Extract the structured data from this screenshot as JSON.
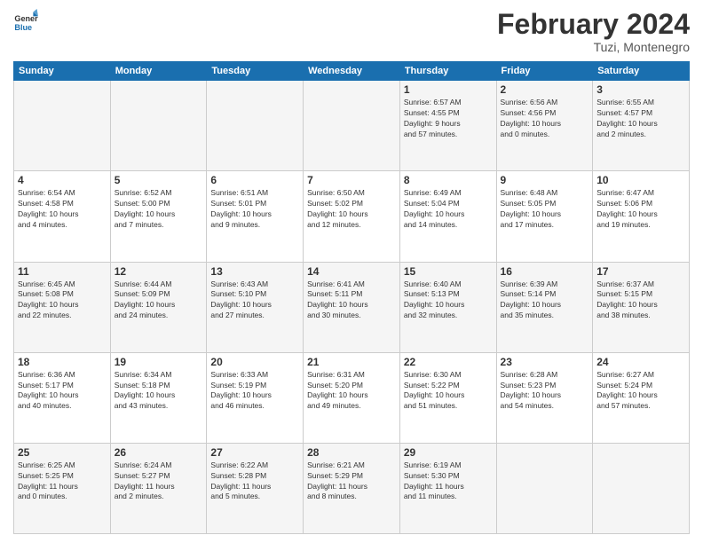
{
  "logo": {
    "line1": "General",
    "line2": "Blue"
  },
  "title": "February 2024",
  "location": "Tuzi, Montenegro",
  "headers": [
    "Sunday",
    "Monday",
    "Tuesday",
    "Wednesday",
    "Thursday",
    "Friday",
    "Saturday"
  ],
  "weeks": [
    [
      {
        "day": "",
        "info": ""
      },
      {
        "day": "",
        "info": ""
      },
      {
        "day": "",
        "info": ""
      },
      {
        "day": "",
        "info": ""
      },
      {
        "day": "1",
        "info": "Sunrise: 6:57 AM\nSunset: 4:55 PM\nDaylight: 9 hours\nand 57 minutes."
      },
      {
        "day": "2",
        "info": "Sunrise: 6:56 AM\nSunset: 4:56 PM\nDaylight: 10 hours\nand 0 minutes."
      },
      {
        "day": "3",
        "info": "Sunrise: 6:55 AM\nSunset: 4:57 PM\nDaylight: 10 hours\nand 2 minutes."
      }
    ],
    [
      {
        "day": "4",
        "info": "Sunrise: 6:54 AM\nSunset: 4:58 PM\nDaylight: 10 hours\nand 4 minutes."
      },
      {
        "day": "5",
        "info": "Sunrise: 6:52 AM\nSunset: 5:00 PM\nDaylight: 10 hours\nand 7 minutes."
      },
      {
        "day": "6",
        "info": "Sunrise: 6:51 AM\nSunset: 5:01 PM\nDaylight: 10 hours\nand 9 minutes."
      },
      {
        "day": "7",
        "info": "Sunrise: 6:50 AM\nSunset: 5:02 PM\nDaylight: 10 hours\nand 12 minutes."
      },
      {
        "day": "8",
        "info": "Sunrise: 6:49 AM\nSunset: 5:04 PM\nDaylight: 10 hours\nand 14 minutes."
      },
      {
        "day": "9",
        "info": "Sunrise: 6:48 AM\nSunset: 5:05 PM\nDaylight: 10 hours\nand 17 minutes."
      },
      {
        "day": "10",
        "info": "Sunrise: 6:47 AM\nSunset: 5:06 PM\nDaylight: 10 hours\nand 19 minutes."
      }
    ],
    [
      {
        "day": "11",
        "info": "Sunrise: 6:45 AM\nSunset: 5:08 PM\nDaylight: 10 hours\nand 22 minutes."
      },
      {
        "day": "12",
        "info": "Sunrise: 6:44 AM\nSunset: 5:09 PM\nDaylight: 10 hours\nand 24 minutes."
      },
      {
        "day": "13",
        "info": "Sunrise: 6:43 AM\nSunset: 5:10 PM\nDaylight: 10 hours\nand 27 minutes."
      },
      {
        "day": "14",
        "info": "Sunrise: 6:41 AM\nSunset: 5:11 PM\nDaylight: 10 hours\nand 30 minutes."
      },
      {
        "day": "15",
        "info": "Sunrise: 6:40 AM\nSunset: 5:13 PM\nDaylight: 10 hours\nand 32 minutes."
      },
      {
        "day": "16",
        "info": "Sunrise: 6:39 AM\nSunset: 5:14 PM\nDaylight: 10 hours\nand 35 minutes."
      },
      {
        "day": "17",
        "info": "Sunrise: 6:37 AM\nSunset: 5:15 PM\nDaylight: 10 hours\nand 38 minutes."
      }
    ],
    [
      {
        "day": "18",
        "info": "Sunrise: 6:36 AM\nSunset: 5:17 PM\nDaylight: 10 hours\nand 40 minutes."
      },
      {
        "day": "19",
        "info": "Sunrise: 6:34 AM\nSunset: 5:18 PM\nDaylight: 10 hours\nand 43 minutes."
      },
      {
        "day": "20",
        "info": "Sunrise: 6:33 AM\nSunset: 5:19 PM\nDaylight: 10 hours\nand 46 minutes."
      },
      {
        "day": "21",
        "info": "Sunrise: 6:31 AM\nSunset: 5:20 PM\nDaylight: 10 hours\nand 49 minutes."
      },
      {
        "day": "22",
        "info": "Sunrise: 6:30 AM\nSunset: 5:22 PM\nDaylight: 10 hours\nand 51 minutes."
      },
      {
        "day": "23",
        "info": "Sunrise: 6:28 AM\nSunset: 5:23 PM\nDaylight: 10 hours\nand 54 minutes."
      },
      {
        "day": "24",
        "info": "Sunrise: 6:27 AM\nSunset: 5:24 PM\nDaylight: 10 hours\nand 57 minutes."
      }
    ],
    [
      {
        "day": "25",
        "info": "Sunrise: 6:25 AM\nSunset: 5:25 PM\nDaylight: 11 hours\nand 0 minutes."
      },
      {
        "day": "26",
        "info": "Sunrise: 6:24 AM\nSunset: 5:27 PM\nDaylight: 11 hours\nand 2 minutes."
      },
      {
        "day": "27",
        "info": "Sunrise: 6:22 AM\nSunset: 5:28 PM\nDaylight: 11 hours\nand 5 minutes."
      },
      {
        "day": "28",
        "info": "Sunrise: 6:21 AM\nSunset: 5:29 PM\nDaylight: 11 hours\nand 8 minutes."
      },
      {
        "day": "29",
        "info": "Sunrise: 6:19 AM\nSunset: 5:30 PM\nDaylight: 11 hours\nand 11 minutes."
      },
      {
        "day": "",
        "info": ""
      },
      {
        "day": "",
        "info": ""
      }
    ]
  ]
}
